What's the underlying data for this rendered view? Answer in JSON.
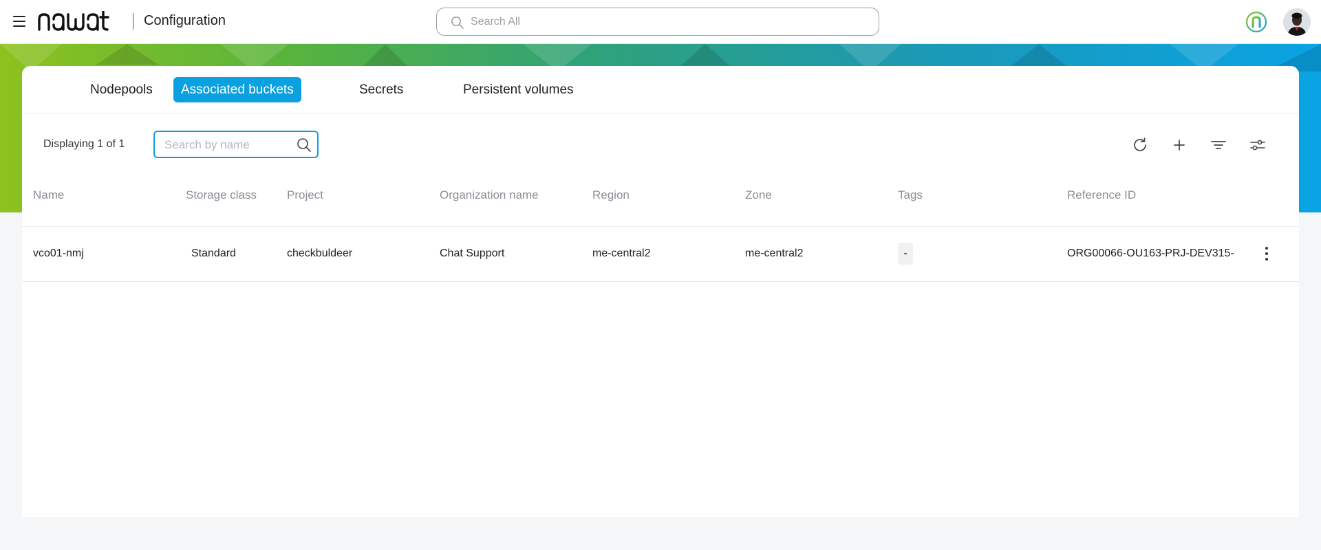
{
  "header": {
    "logo_text": "nawat",
    "title": "Configuration",
    "search_placeholder": "Search All",
    "menu_icon": "hamburger-menu-icon",
    "brand_badge_icon": "brand-n-icon"
  },
  "tabs": [
    {
      "label": "Nodepools",
      "active": false
    },
    {
      "label": "Associated buckets",
      "active": true
    },
    {
      "label": "Secrets",
      "active": false
    },
    {
      "label": "Persistent volumes",
      "active": false
    }
  ],
  "toolbar": {
    "count_text": "Displaying 1 of 1",
    "search_placeholder": "Search by name",
    "icons": [
      "refresh-icon",
      "add-icon",
      "filter-icon",
      "column-settings-icon"
    ]
  },
  "table": {
    "columns": [
      "Name",
      "Storage class",
      "Project",
      "Organization name",
      "Region",
      "Zone",
      "Tags",
      "Reference ID"
    ],
    "rows": [
      {
        "name": "vco01-nmj",
        "storage_class": "Standard",
        "project": "checkbuldeer",
        "organization": "Chat Support",
        "region": "me-central2",
        "zone": "me-central2",
        "tags": "-",
        "reference_id": "ORG00066-OU163-PRJ-DEV315-"
      }
    ]
  },
  "colors": {
    "accent": "#0ba1e0",
    "gradient": [
      "#8dc21f",
      "#58b43d",
      "#2fa27a",
      "#1b99b5",
      "#0aa3e4"
    ]
  }
}
